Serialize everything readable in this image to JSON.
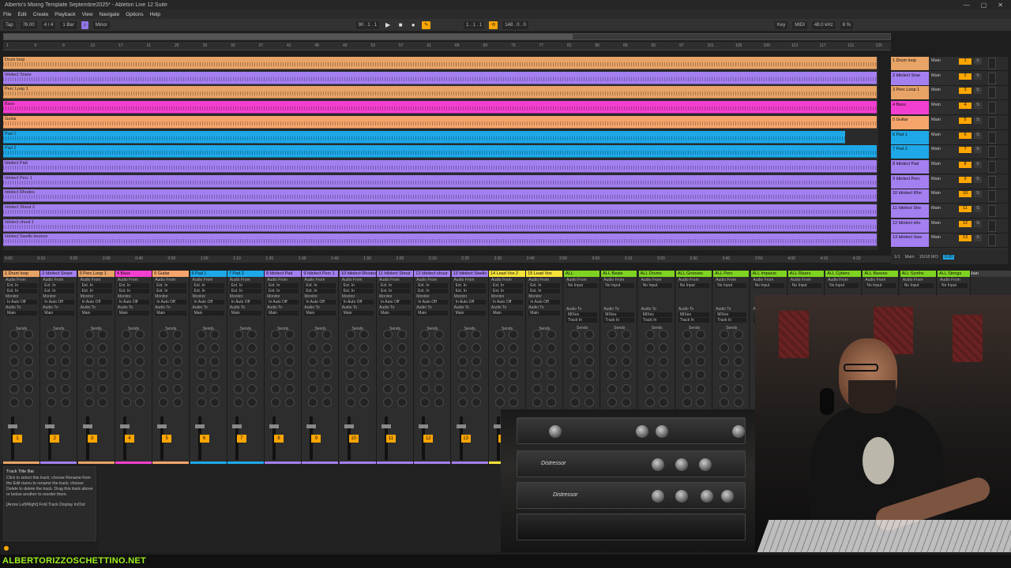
{
  "window": {
    "title": "Alberto's Mixing Template Septembre2025* - Ableton Live 12 Suite",
    "controls": [
      "—",
      "▢",
      "✕"
    ]
  },
  "menu": [
    "File",
    "Edit",
    "Create",
    "Playback",
    "View",
    "Navigate",
    "Options",
    "Help"
  ],
  "transport": {
    "tap": "Tap",
    "tempo": "76.00",
    "time_sig": "4 / 4",
    "quantize": "1 Bar",
    "scale": "Minor",
    "position": "90 . 1 . 1",
    "loop_start": "1 . 1 . 1",
    "loop_length": "148 . 0 . 0",
    "key": "Key",
    "midi": "MIDI",
    "cpu": "48.0 kHz",
    "cpu_load": "8 %",
    "set": "Set"
  },
  "ruler_ticks": [
    "1",
    "5",
    "9",
    "13",
    "17",
    "21",
    "25",
    "29",
    "33",
    "37",
    "41",
    "45",
    "49",
    "53",
    "57",
    "61",
    "65",
    "69",
    "73",
    "77",
    "81",
    "85",
    "89",
    "93",
    "97",
    "101",
    "105",
    "109",
    "113",
    "117",
    "121",
    "125"
  ],
  "time_ticks": [
    "0:00",
    "0:10",
    "0:20",
    "0:30",
    "0:40",
    "0:50",
    "1:00",
    "1:10",
    "1:20",
    "1:30",
    "1:40",
    "1:50",
    "2:00",
    "2:10",
    "2:20",
    "2:30",
    "2:40",
    "2:50",
    "3:00",
    "3:10",
    "3:20",
    "3:30",
    "3:40",
    "3:50",
    "4:00",
    "4:10",
    "4:20"
  ],
  "tracks": [
    {
      "clip": "Drum loop",
      "name": "1 Drum loop",
      "num": "1",
      "color": "#e8a366"
    },
    {
      "clip": "Idiolect Snare",
      "name": "2 Idiolect Snar",
      "num": "2",
      "color": "#a47ff0"
    },
    {
      "clip": "Perc Loop 1",
      "name": "3 Perc Loop 1",
      "num": "3",
      "color": "#e8a366"
    },
    {
      "clip": "Bass",
      "name": "4 Bass",
      "num": "4",
      "color": "#f33fd0"
    },
    {
      "clip": "Guitar",
      "name": "5 Guitar",
      "num": "5",
      "color": "#f5a56b"
    },
    {
      "clip": "Pad 1",
      "name": "6 Pad 1",
      "num": "6",
      "color": "#1ea8e8"
    },
    {
      "clip": "Pad 2",
      "name": "7 Pad 2",
      "num": "7",
      "color": "#1ea8e8"
    },
    {
      "clip": "Idiolect Pad",
      "name": "8 Idiolect Pad",
      "num": "8",
      "color": "#a47ff0"
    },
    {
      "clip": "Idiolect Perc 1",
      "name": "9 Idiolect Perc",
      "num": "9",
      "color": "#a47ff0"
    },
    {
      "clip": "Idiolect Rhodes",
      "name": "10 Idiolect Rho",
      "num": "10",
      "color": "#a47ff0"
    },
    {
      "clip": "Idiolect Shout 2",
      "name": "11 Idiolect Sho",
      "num": "11",
      "color": "#a47ff0"
    },
    {
      "clip": "Idiolect shout 1",
      "name": "12 Idiolect sho",
      "num": "12",
      "color": "#a47ff0"
    },
    {
      "clip": "Idiolect Swells bounce",
      "name": "13 Idiolect Swe",
      "num": "13",
      "color": "#a47ff0"
    }
  ],
  "track_output": "Main",
  "status_right": {
    "count": "1/1",
    "main": "Main",
    "selection": "15/18 MO",
    "level": "0.00"
  },
  "mixer": {
    "labels": {
      "audio_from": "Audio From",
      "ext_in": "Ext. In",
      "monitor": "Monitor",
      "monitor_opts": "In  Auto  Off",
      "audio_to": "Audio To",
      "main": "Main",
      "sends": "Sends",
      "no_input": "No Input",
      "mixes": "MIXes",
      "track_in": "Track In"
    },
    "strips": [
      {
        "name": "1 Drum loop",
        "color": "#e8a366",
        "num": "1"
      },
      {
        "name": "2 Idiolect Snare",
        "color": "#a47ff0",
        "num": "2"
      },
      {
        "name": "3 Perc Loop 1",
        "color": "#e8a366",
        "num": "3"
      },
      {
        "name": "4 Bass",
        "color": "#f33fd0",
        "num": "4"
      },
      {
        "name": "5 Guitar",
        "color": "#f5a56b",
        "num": "5"
      },
      {
        "name": "6 Pad 1",
        "color": "#1ea8e8",
        "num": "6"
      },
      {
        "name": "7 Pad 2",
        "color": "#1ea8e8",
        "num": "7"
      },
      {
        "name": "8 Idiolect Pad",
        "color": "#a47ff0",
        "num": "8"
      },
      {
        "name": "9 Idiolect Perc 1",
        "color": "#a47ff0",
        "num": "9"
      },
      {
        "name": "10 Idiolect Rhodes",
        "color": "#a47ff0",
        "num": "10"
      },
      {
        "name": "11 Idiolect Shout",
        "color": "#a47ff0",
        "num": "11"
      },
      {
        "name": "12 Idiolect shout",
        "color": "#a47ff0",
        "num": "12"
      },
      {
        "name": "13 Idiolect Swells",
        "color": "#a47ff0",
        "num": "13"
      },
      {
        "name": "14 Lead Vox 2",
        "color": "#f5e23a",
        "num": "14"
      },
      {
        "name": "15 Lead Vox",
        "color": "#f5e23a",
        "num": ""
      }
    ],
    "groups": [
      {
        "name": "ALL",
        "color": "#7ed321"
      },
      {
        "name": "ALL Beats",
        "color": "#7ed321"
      },
      {
        "name": "ALL Drums",
        "color": "#7ed321"
      },
      {
        "name": "ALL Grooves",
        "color": "#7ed321"
      },
      {
        "name": "ALL Perc",
        "color": "#7ed321"
      },
      {
        "name": "ALL Impacts",
        "color": "#7ed321"
      },
      {
        "name": "ALL Risers",
        "color": "#7ed321"
      },
      {
        "name": "ALL Cybers",
        "color": "#7ed321"
      },
      {
        "name": "ALL Basses",
        "color": "#7ed321"
      },
      {
        "name": "ALL Synths",
        "color": "#7ed321"
      },
      {
        "name": "ALL Strings",
        "color": "#7ed321"
      }
    ],
    "main": "Main"
  },
  "info": {
    "title": "Track Title Bar",
    "body": "Click to select this track; choose Rename from the Edit menu to rename the track; choose Delete to delete the track. Drag this track above or below another to reorder them.",
    "hint": "[Arrow Left/Right] Fold Track Display In/Out"
  },
  "video": {
    "rack_label_1": "Distressor",
    "rack_label_2": "Distressor"
  },
  "footer": {
    "url": "ALBERTORIZZOSCHETTINO.NET",
    "url_color": "#9ef01a"
  }
}
